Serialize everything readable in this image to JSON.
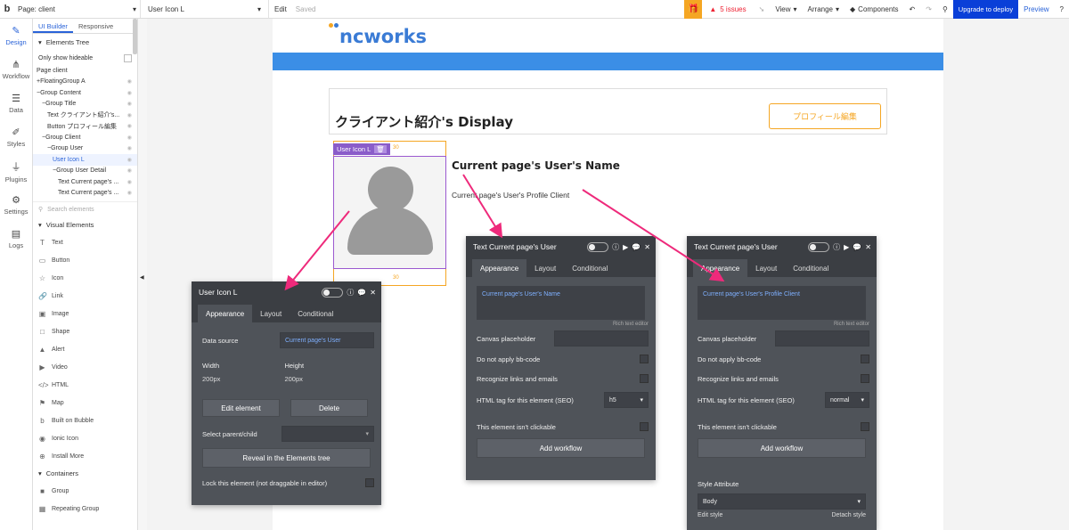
{
  "topbar": {
    "logo": "b",
    "page_label": "Page: client",
    "element_label": "User Icon L",
    "edit": "Edit",
    "saved": "Saved",
    "issues": "5 issues",
    "view": "View",
    "arrange": "Arrange",
    "components": "Components",
    "deploy": "Upgrade to deploy",
    "preview": "Preview"
  },
  "rail": [
    {
      "label": "Design",
      "icon": "design-icon"
    },
    {
      "label": "Workflow",
      "icon": "workflow-icon"
    },
    {
      "label": "Data",
      "icon": "data-icon"
    },
    {
      "label": "Styles",
      "icon": "styles-icon"
    },
    {
      "label": "Plugins",
      "icon": "plugins-icon"
    },
    {
      "label": "Settings",
      "icon": "settings-icon"
    },
    {
      "label": "Logs",
      "icon": "logs-icon"
    }
  ],
  "left_panel": {
    "tab_builder": "UI Builder",
    "tab_responsive": "Responsive",
    "tree_title": "Elements Tree",
    "only_hideable": "Only show hideable",
    "tree": [
      {
        "label": "Page client",
        "indent": 0
      },
      {
        "label": "+FloatingGroup A",
        "indent": 0
      },
      {
        "label": "−Group Content",
        "indent": 0
      },
      {
        "label": "−Group Title",
        "indent": 1
      },
      {
        "label": "Text クライアント紹介's...",
        "indent": 2
      },
      {
        "label": "Button プロフィール編集",
        "indent": 2
      },
      {
        "label": "−Group Client",
        "indent": 1
      },
      {
        "label": "−Group User",
        "indent": 2
      },
      {
        "label": "User Icon L",
        "indent": 3
      },
      {
        "label": "−Group User Detail",
        "indent": 3
      },
      {
        "label": "Text Current page's ...",
        "indent": 4
      },
      {
        "label": "Text Current page's ...",
        "indent": 4
      }
    ],
    "search_placeholder": "Search elements",
    "visual_title": "Visual Elements",
    "visual": [
      "Text",
      "Button",
      "Icon",
      "Link",
      "Image",
      "Shape",
      "Alert",
      "Video",
      "HTML",
      "Map",
      "Built on Bubble",
      "Ionic Icon",
      "Install More"
    ],
    "containers_title": "Containers",
    "containers": [
      "Group",
      "Repeating Group"
    ]
  },
  "canvas": {
    "logo": "ncworks",
    "title": "クライアント紹介's Display",
    "profile_button": "プロフィール編集",
    "selected_tag": "User Icon L",
    "dim_top": "30",
    "dim_bottom": "30",
    "user_name": "Current page's User's Name",
    "user_profile": "Current page's User's Profile Client"
  },
  "panel_icon": {
    "title": "User Icon L",
    "tabs": [
      "Appearance",
      "Layout",
      "Conditional"
    ],
    "data_source_label": "Data source",
    "data_source_value": "Current page's User",
    "width_label": "Width",
    "width_value": "200px",
    "height_label": "Height",
    "height_value": "200px",
    "edit_element": "Edit element",
    "delete": "Delete",
    "select_parent": "Select parent/child",
    "reveal": "Reveal in the Elements tree",
    "lock": "Lock this element (not draggable in editor)"
  },
  "panel_name": {
    "title": "Text Current page's User",
    "tabs": [
      "Appearance",
      "Layout",
      "Conditional"
    ],
    "rte_value": "Current page's User's Name",
    "rte_hint": "Rich text editor",
    "canvas_placeholder": "Canvas placeholder",
    "no_bbcode": "Do not apply bb-code",
    "recognize": "Recognize links and emails",
    "html_tag_label": "HTML tag for this element (SEO)",
    "html_tag_value": "h5",
    "not_clickable": "This element isn't clickable",
    "add_workflow": "Add workflow"
  },
  "panel_profile": {
    "title": "Text Current page's User",
    "tabs": [
      "Appearance",
      "Layout",
      "Conditional"
    ],
    "rte_value": "Current page's User's Profile Client",
    "rte_hint": "Rich text editor",
    "canvas_placeholder": "Canvas placeholder",
    "no_bbcode": "Do not apply bb-code",
    "recognize": "Recognize links and emails",
    "html_tag_label": "HTML tag for this element (SEO)",
    "html_tag_value": "normal",
    "not_clickable": "This element isn't clickable",
    "add_workflow": "Add workflow",
    "style_attr": "Style Attribute",
    "style_value": "Body",
    "edit_style": "Edit style",
    "detach_style": "Detach style"
  },
  "colors": {
    "accent_blue": "#2a63d8",
    "deploy_blue": "#0a3fd8",
    "orange": "#f5a623",
    "purple": "#8a5cc9",
    "arrow_pink": "#ee2a7b",
    "panel_bg": "#4f5359"
  }
}
